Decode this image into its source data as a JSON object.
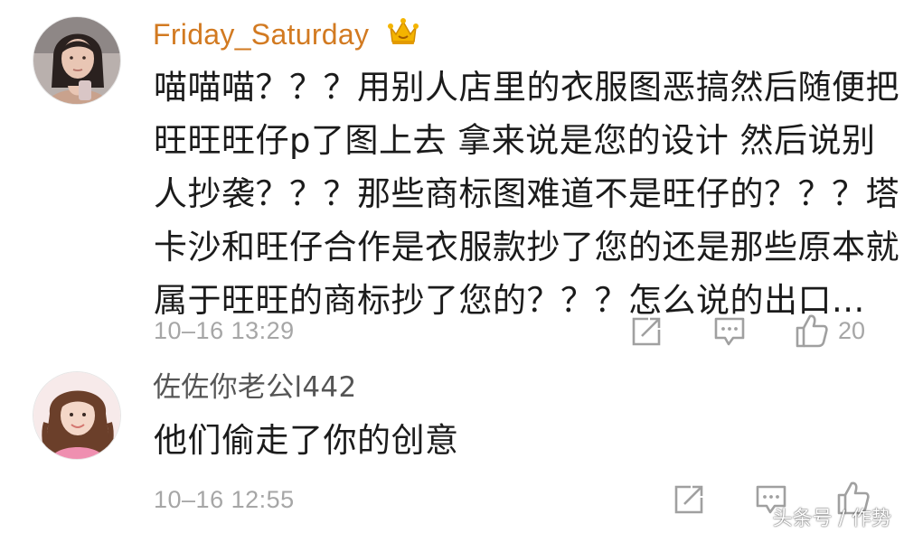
{
  "colors": {
    "vip_username": "#d27a21",
    "normal_username": "#555555",
    "text": "#1b1b1b",
    "meta": "#a6a6a6",
    "icon": "#a0a0a0"
  },
  "comments": [
    {
      "username": "Friday_Saturday",
      "badge_icon": "crown-icon",
      "avatar_icon": "avatar-user-icon",
      "text_lines": [
        "喵喵喵？？？用别人店里的衣服图恶搞然后随便把",
        "旺旺旺仔p了图上去 拿来说是您的设计 然后说别",
        "人抄袭？？？那些商标图难道不是旺仔的？？？塔",
        "卡沙和旺仔合作是衣服款抄了您的还是那些原本就",
        "属于旺旺的商标抄了您的？？？怎么说的出口..."
      ],
      "timestamp": "10–16 13:29",
      "like_count": "20"
    },
    {
      "username": "佐佐你老公l442",
      "avatar_icon": "avatar-user-icon",
      "text_lines": [
        "他们偷走了你的创意"
      ],
      "timestamp": "10–16 12:55",
      "like_count": ""
    }
  ],
  "watermark": "头条号 / 作势"
}
